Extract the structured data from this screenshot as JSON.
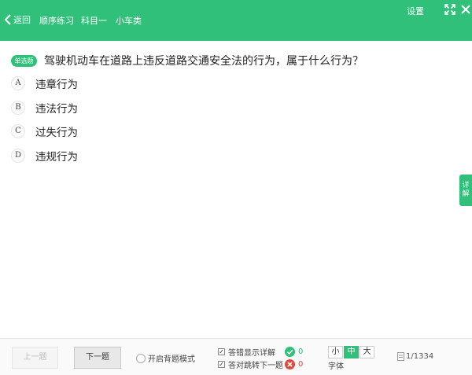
{
  "header": {
    "back_label": "返回",
    "breadcrumbs": [
      "顺序练习",
      "科目一",
      "小车类"
    ],
    "settings_label": "设置"
  },
  "question": {
    "type_badge": "单选题",
    "text": "驾驶机动车在道路上违反道路交通安全法的行为，属于什么行为？",
    "options": [
      {
        "letter": "A",
        "text": "违章行为"
      },
      {
        "letter": "B",
        "text": "违法行为"
      },
      {
        "letter": "C",
        "text": "过失行为"
      },
      {
        "letter": "D",
        "text": "违规行为"
      }
    ]
  },
  "side_tab": {
    "label": "详解"
  },
  "bottom": {
    "prev_label": "上一题",
    "next_label": "下一题",
    "memorize_label": "开启背题模式",
    "show_detail_label": "答错显示详解",
    "auto_next_label": "答对跳转下一题",
    "correct_count": "0",
    "wrong_count": "0",
    "font_sizes": [
      "小",
      "中",
      "大"
    ],
    "font_selected": "中",
    "font_label": "字体",
    "progress": "1/1334"
  },
  "colors": {
    "brand": "#30c07a",
    "wrong": "#e04a3f"
  },
  "icons": [
    "chevron-left-icon",
    "maximize-icon",
    "close-icon",
    "check-circle-icon",
    "x-circle-icon",
    "document-icon"
  ]
}
